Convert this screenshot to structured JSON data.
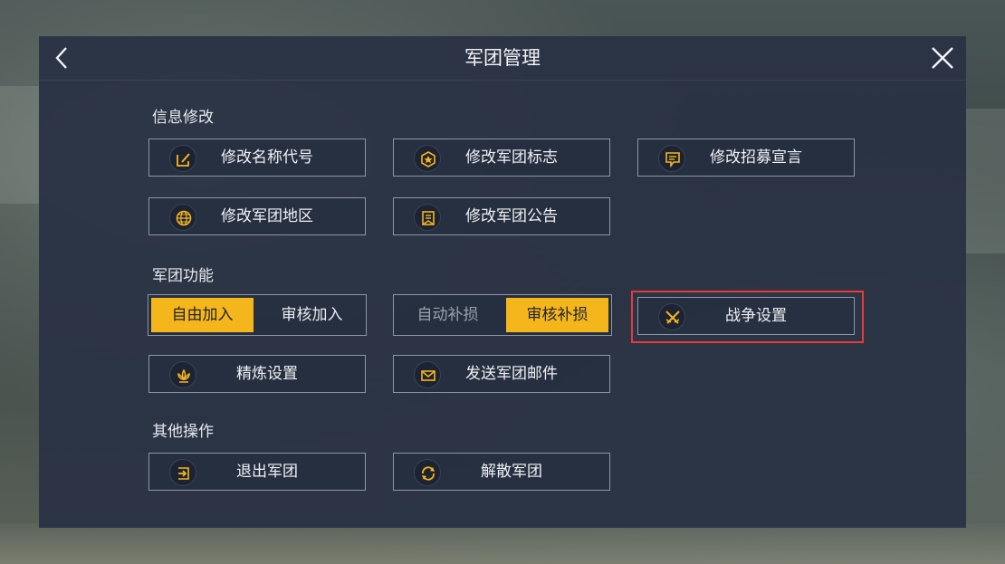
{
  "header": {
    "title": "军团管理",
    "back_icon": "back-arrow-icon",
    "close_icon": "close-icon"
  },
  "sections": {
    "info": {
      "label": "信息修改",
      "buttons": [
        {
          "label": "修改名称代号",
          "icon": "edit-icon"
        },
        {
          "label": "修改军团标志",
          "icon": "badge-icon"
        },
        {
          "label": "修改招募宣言",
          "icon": "message-icon"
        },
        {
          "label": "修改军团地区",
          "icon": "globe-icon"
        },
        {
          "label": "修改军团公告",
          "icon": "notice-icon"
        }
      ]
    },
    "functions": {
      "label": "军团功能",
      "join_toggle": {
        "options": [
          "自由加入",
          "审核加入"
        ],
        "selected": "自由加入"
      },
      "supply_toggle": {
        "options": [
          "自动补损",
          "审核补损"
        ],
        "selected": "审核补损"
      },
      "war_settings": {
        "label": "战争设置",
        "icon": "crossed-swords-icon",
        "highlighted": true
      },
      "refine_settings": {
        "label": "精炼设置",
        "icon": "lotus-icon"
      },
      "send_mail": {
        "label": "发送军团邮件",
        "icon": "mail-icon"
      }
    },
    "other": {
      "label": "其他操作",
      "buttons": [
        {
          "label": "退出军团",
          "icon": "exit-icon"
        },
        {
          "label": "解散军团",
          "icon": "disband-icon"
        }
      ]
    }
  },
  "colors": {
    "accent": "#f5b61c",
    "highlight_border": "#e53b3b",
    "panel_bg": "#293244"
  }
}
